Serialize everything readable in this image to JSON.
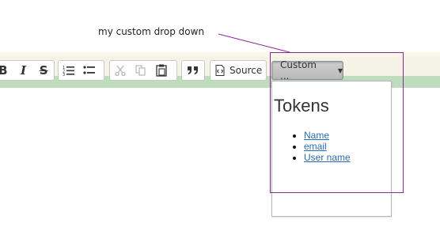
{
  "annotation": {
    "text": "my custom drop down"
  },
  "toolbar": {
    "buttons": [
      {
        "label": "B",
        "icon": "bold-icon"
      },
      {
        "label": "I",
        "icon": "italic-icon"
      },
      {
        "label": "S",
        "icon": "strikethrough-icon"
      },
      {
        "label": "",
        "icon": "numbered-list-icon"
      },
      {
        "label": "",
        "icon": "bulleted-list-icon"
      },
      {
        "label": "",
        "icon": "cut-icon"
      },
      {
        "label": "",
        "icon": "copy-icon"
      },
      {
        "label": "",
        "icon": "paste-icon"
      },
      {
        "label": "",
        "icon": "blockquote-icon"
      }
    ],
    "source_label": "Source",
    "custom_dropdown_label": "Custom ..."
  },
  "dropdown": {
    "heading": "Tokens",
    "items": [
      {
        "label": "Name"
      },
      {
        "label": "email"
      },
      {
        "label": "User name"
      }
    ]
  },
  "colors": {
    "highlight": "#8a2a9a",
    "link": "#2a6cb0",
    "green_band": "#bfdcbc"
  }
}
